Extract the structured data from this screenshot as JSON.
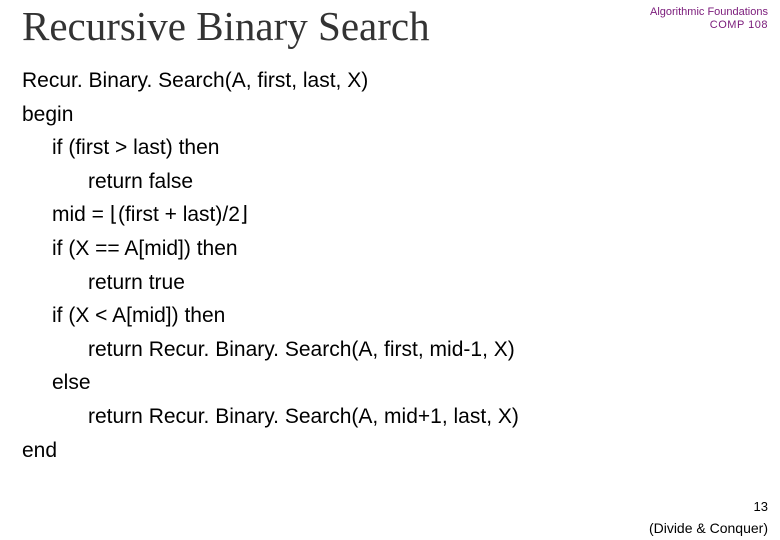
{
  "corner": {
    "subject": "Algorithmic Foundations",
    "code": "COMP 108"
  },
  "title": "Recursive Binary Search",
  "algo": {
    "l0": "Recur. Binary. Search(A, first, last, X)",
    "l1": "begin",
    "l2": "if (first > last) then",
    "l3": "return false",
    "l4": "mid = ⌊(first + last)/2⌋",
    "l5": "if (X == A[mid]) then",
    "l6": "return true",
    "l7": "if (X < A[mid]) then",
    "l8": "return Recur. Binary. Search(A, first, mid-1, X)",
    "l9": "else",
    "l10": "return Recur. Binary. Search(A, mid+1, last, X)",
    "l11": "end"
  },
  "pagenum": "13",
  "footer": "(Divide & Conquer)"
}
